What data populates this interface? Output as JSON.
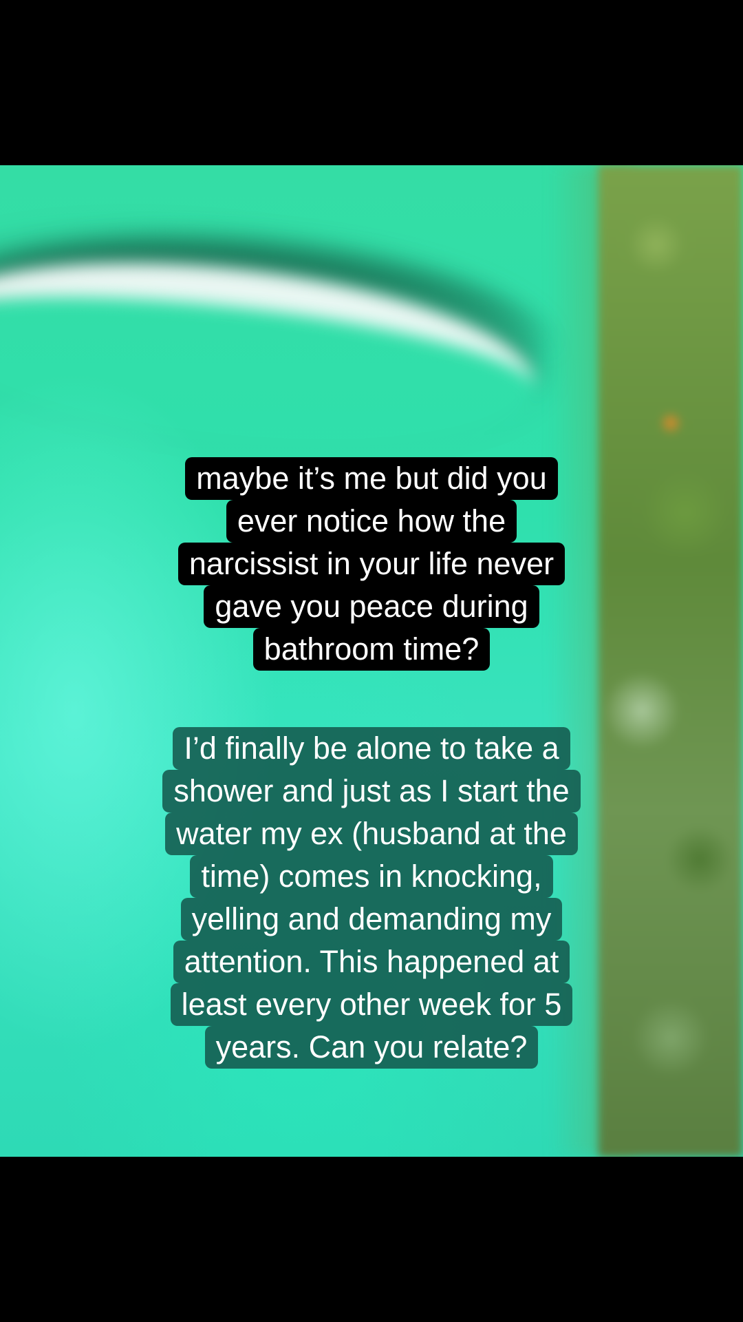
{
  "video": {
    "background_colors": {
      "aqua": "#2fe0ad",
      "foliage": "#6c9a3f",
      "flower": "#e08a2a"
    }
  },
  "caption_top": {
    "lines": [
      "maybe it’s me but did you",
      "ever notice how the",
      "narcissist in your life never",
      "gave you peace during",
      "bathroom time?"
    ],
    "background": "#000000"
  },
  "caption_bottom": {
    "lines": [
      "I’d finally be alone to take a",
      "shower and just as I start the",
      "water my ex (husband at the",
      "time) comes in knocking,",
      "yelling and demanding my",
      "attention. This happened at",
      "least every other week for 5",
      "years. Can you relate?"
    ],
    "background": "#145a4e"
  }
}
